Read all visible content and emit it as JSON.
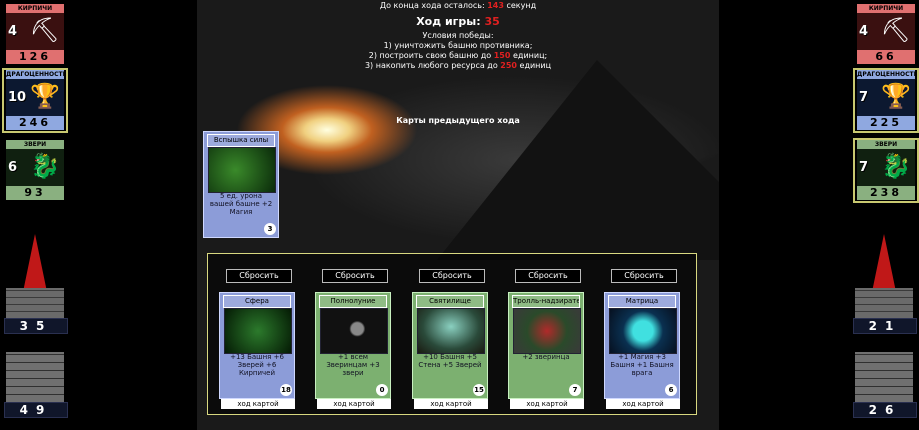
{
  "header": {
    "timer_prefix": "До конца хода осталось:",
    "timer_value": "143",
    "timer_suffix": "секунд",
    "turn_label": "Ход игры:",
    "turn_value": "35",
    "victory_title": "Условия победы:",
    "cond1": "1) уничтожить башню противника;",
    "cond2_a": "2) построить свою башню до",
    "cond2_v": "150",
    "cond2_b": "единиц;",
    "cond3_a": "3) накопить любого ресурса до",
    "cond3_v": "250",
    "cond3_b": "единиц"
  },
  "prev_title": "Карты предыдущего хода",
  "prev_card": {
    "title": "Вспышка силы",
    "desc": "5 ед. урона вашей башне +2 Магия",
    "cost": "3"
  },
  "player": {
    "bricks": {
      "label": "КИРПИЧИ",
      "count": "4",
      "amount": "126"
    },
    "gems": {
      "label": "ДРАГОЦЕННОСТИ",
      "count": "10",
      "amount": "246"
    },
    "beasts": {
      "label": "ЗВЕРИ",
      "count": "6",
      "amount": "93"
    },
    "tower": "35",
    "wall": "49"
  },
  "enemy": {
    "bricks": {
      "label": "КИРПИЧИ",
      "count": "4",
      "amount": "66"
    },
    "gems": {
      "label": "ДРАГОЦЕННОСТИ",
      "count": "7",
      "amount": "225"
    },
    "beasts": {
      "label": "ЗВЕРИ",
      "count": "7",
      "amount": "238"
    },
    "tower": "21",
    "wall": "26"
  },
  "hand": {
    "discard_label": "Сбросить",
    "play_label": "ход картой",
    "cards": [
      {
        "title": "Сфера",
        "desc": "+13 Башня +6 Зверей +6 Кирпичей",
        "cost": "18"
      },
      {
        "title": "Полнолуние",
        "desc": "+1 всем Зверинцам +3 звери",
        "cost": "0"
      },
      {
        "title": "Святилище",
        "desc": "+10 Башня +5 Стена +5 Зверей",
        "cost": "15"
      },
      {
        "title": "Тролль-надзиратель",
        "desc": "+2 зверинца",
        "cost": "7"
      },
      {
        "title": "Матрица",
        "desc": "+1 Магия +3 Башня +1 Башня врага",
        "cost": "6"
      }
    ]
  }
}
